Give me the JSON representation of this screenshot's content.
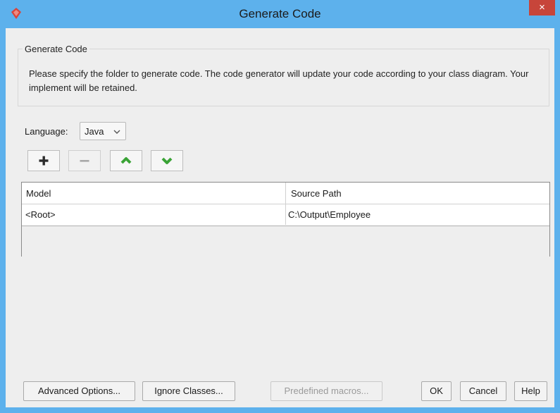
{
  "window": {
    "title": "Generate Code",
    "close_label": "×"
  },
  "group": {
    "legend": "Generate Code",
    "description": "Please specify the folder to generate code. The code generator will update your code according to your class diagram. Your implement will be retained."
  },
  "language": {
    "label": "Language:",
    "selected": "Java"
  },
  "toolbar": {
    "icons": [
      "plus-icon",
      "minus-icon",
      "move-up-icon",
      "move-down-icon"
    ]
  },
  "table": {
    "columns": [
      "Model",
      "Source Path"
    ],
    "rows": [
      [
        "<Root>",
        "C:\\Output\\Employee"
      ]
    ]
  },
  "buttons": {
    "advanced": "Advanced Options...",
    "ignore": "Ignore Classes...",
    "predefined": "Predefined macros...",
    "ok": "OK",
    "cancel": "Cancel",
    "help": "Help"
  },
  "colors": {
    "titlebar": "#5db1ec",
    "close": "#c7453a",
    "accent_green": "#3aa336",
    "app_icon": "#d9443a"
  }
}
